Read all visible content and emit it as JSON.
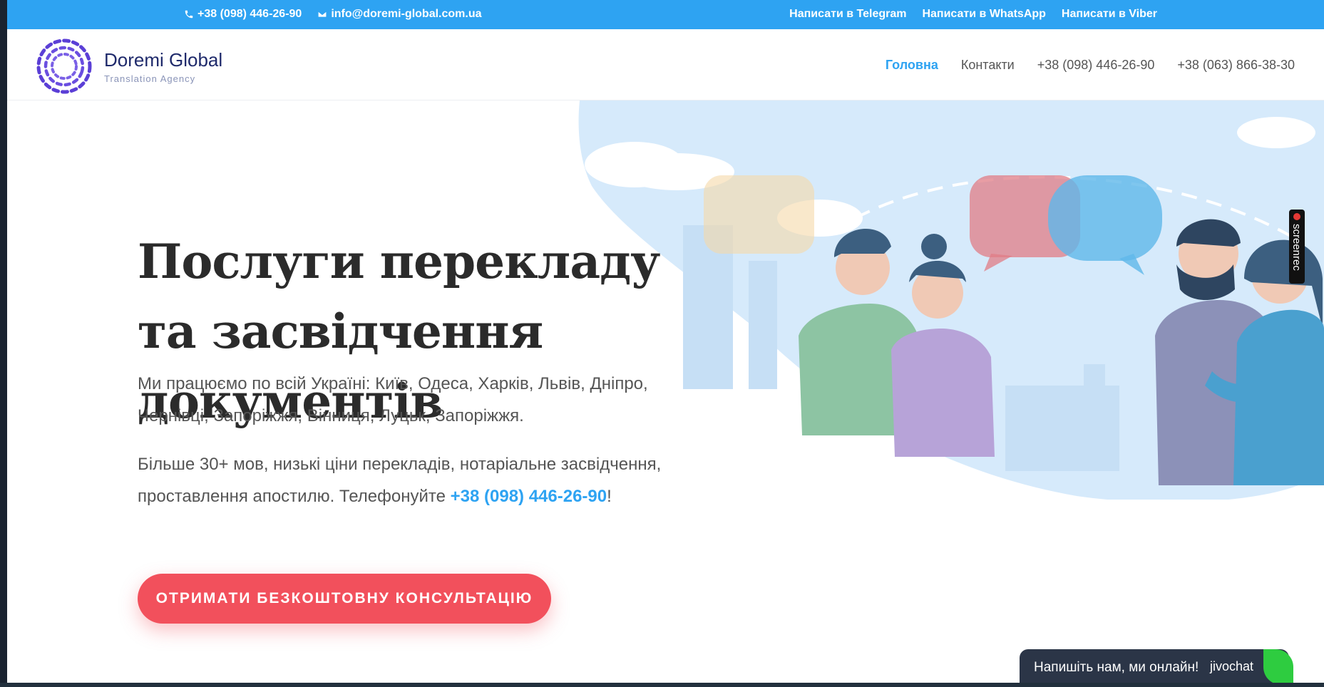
{
  "topbar": {
    "phone": "+38 (098) 446-26-90",
    "email": "info@doremi-global.com.ua",
    "links": [
      "Написати в Telegram",
      "Написати в WhatsApp",
      "Написати в Viber"
    ]
  },
  "header": {
    "logo_name": "Doremi Global",
    "logo_sub": "Translation Agency",
    "nav": [
      "Головна",
      "Контакти",
      "+38 (098) 446-26-90",
      "+38 (063) 866-38-30"
    ]
  },
  "hero": {
    "title": "Послуги перекладу та засвідчення документів",
    "p1": "Ми працюємо по всій Україні: Київ, Одеса, Харків, Львів, Дніпро, Чернівці, Запоріжжя, Вінниця, Луцьк, Запоріжжя.",
    "p2_start": "Більше 30+ мов, низькі ціни перекладів, нотаріальне засвідчення, проставлення апостилю. Телефонуйте ",
    "p2_phone": "+38 (098) 446-26-90",
    "p2_end": "!",
    "cta": "ОТРИМАТИ БЕЗКОШТОВНУ КОНСУЛЬТАЦІЮ"
  },
  "chat": {
    "message": "Напишіть нам, ми онлайн!",
    "brand": "jivochat"
  },
  "screenrec": {
    "label": "screenrec"
  },
  "colors": {
    "accent": "#2ea3f2",
    "cta": "#f2505c",
    "logo": "#5b3fd6"
  }
}
